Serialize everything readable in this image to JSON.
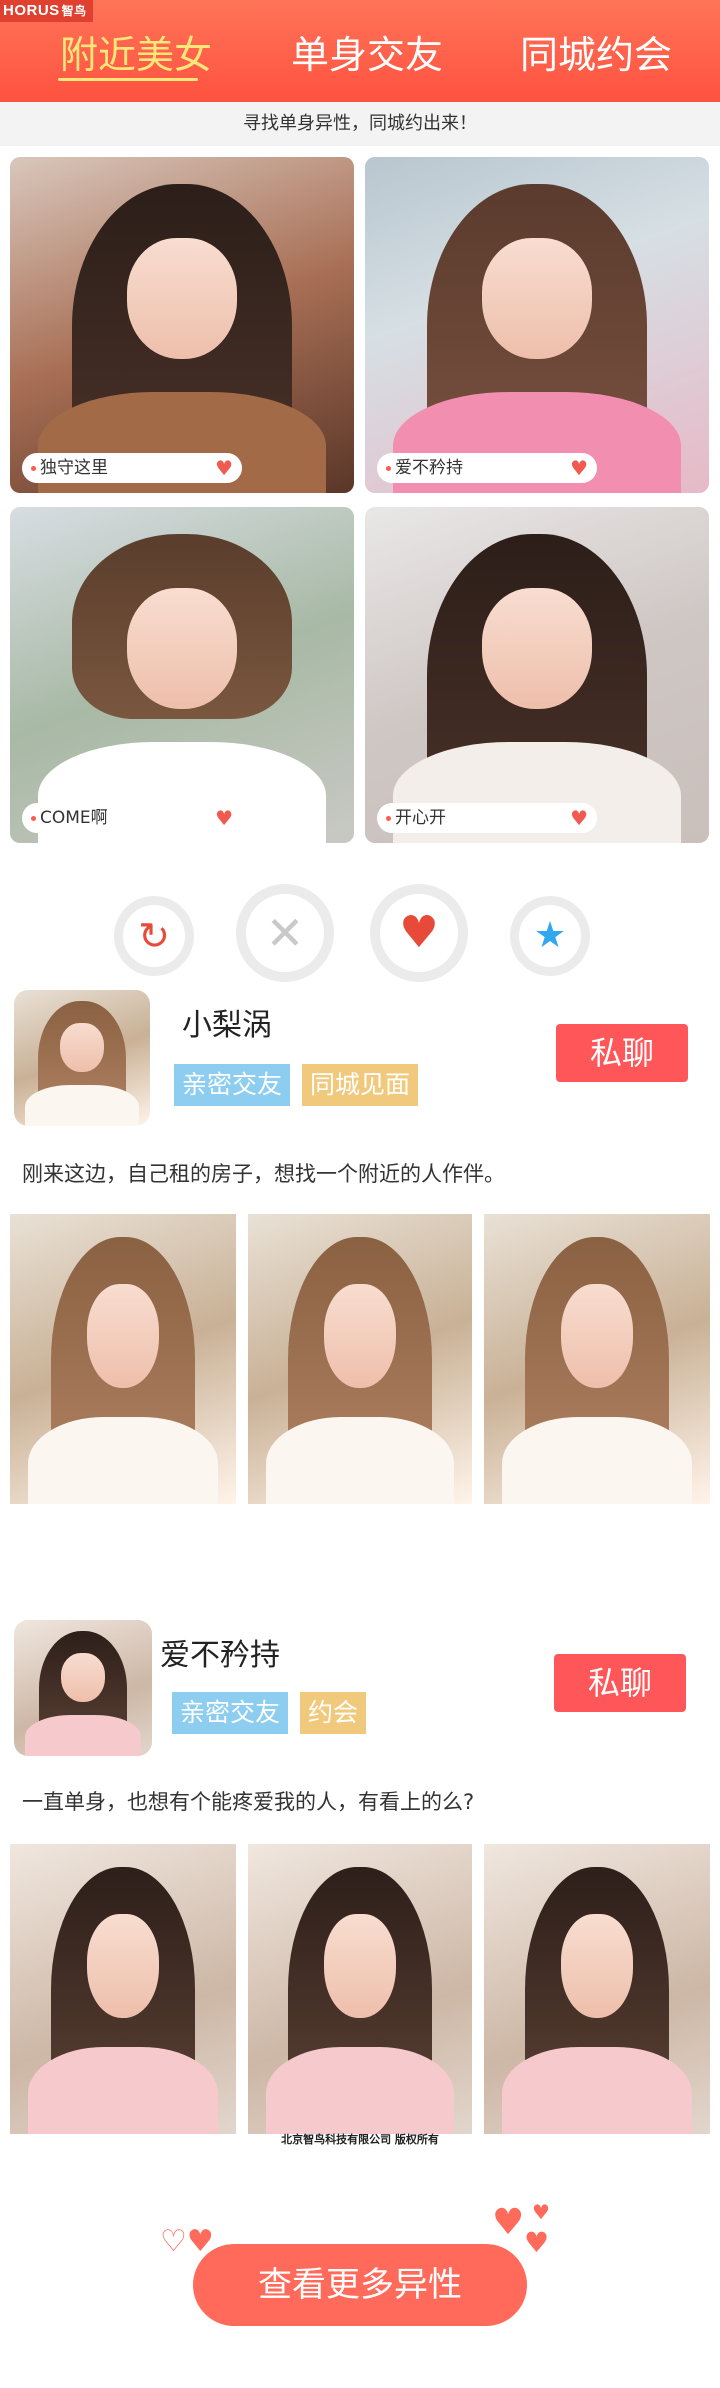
{
  "header": {
    "brand_latin": "HORUS",
    "brand_cn": "智鸟",
    "tabs": [
      {
        "label": "附近美女",
        "active": true
      },
      {
        "label": "单身交友",
        "active": false
      },
      {
        "label": "同城约会",
        "active": false
      }
    ],
    "colors": {
      "bar": "#ff5a44",
      "active_tab": "#ffe77a"
    }
  },
  "subtitle": "寻找单身异性，同城约出来！",
  "cards": [
    {
      "label": "独守这里",
      "icon": "heart-icon"
    },
    {
      "label": "爱不矜持",
      "icon": "heart-icon"
    },
    {
      "label": "COME啊",
      "icon": "heart-icon"
    },
    {
      "label": "开心开",
      "icon": "heart-icon"
    }
  ],
  "actions": [
    {
      "name": "refresh",
      "glyph": "↻",
      "color": "#e84a3a"
    },
    {
      "name": "dislike",
      "glyph": "✕",
      "color": "#c9c9c9"
    },
    {
      "name": "like",
      "glyph": "♥",
      "color": "#e84a3a"
    },
    {
      "name": "favorite",
      "glyph": "★",
      "color": "#31a7f0"
    }
  ],
  "profiles": [
    {
      "name": "小梨涡",
      "tags": [
        "亲密交友",
        "同城见面"
      ],
      "chat_label": "私聊",
      "bio": "刚来这边，自己租的房子，想找一个附近的人作伴。",
      "photo_count": 3
    },
    {
      "name": "爱不矜持",
      "tags": [
        "亲密交友",
        "约会"
      ],
      "chat_label": "私聊",
      "bio": "一直单身，也想有个能疼爱我的人，有看上的么?",
      "photo_count": 3
    }
  ],
  "footer": {
    "copyright": "北京智鸟科技有限公司 版权所有",
    "more_label": "查看更多异性"
  }
}
